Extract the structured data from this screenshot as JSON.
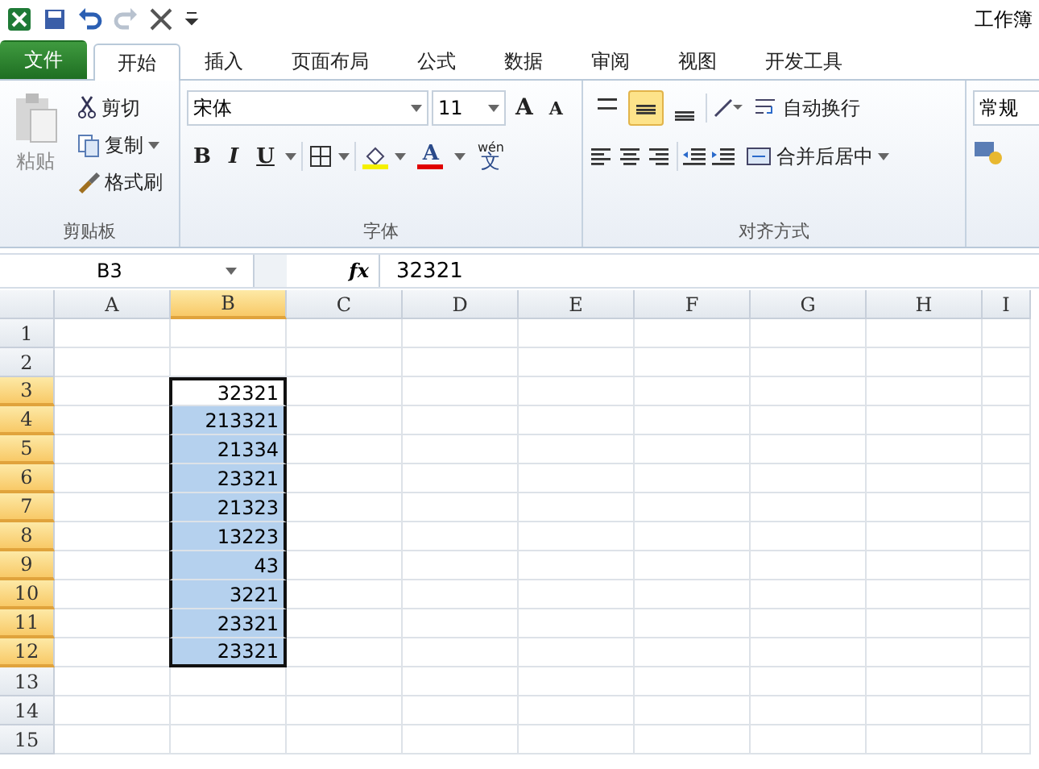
{
  "title_bar": {
    "title": "工作簿"
  },
  "ribbon_tabs": [
    {
      "label": "文件",
      "kind": "file",
      "selected": false
    },
    {
      "label": "开始",
      "kind": "tab",
      "selected": true
    },
    {
      "label": "插入",
      "kind": "tab",
      "selected": false
    },
    {
      "label": "页面布局",
      "kind": "tab",
      "selected": false
    },
    {
      "label": "公式",
      "kind": "tab",
      "selected": false
    },
    {
      "label": "数据",
      "kind": "tab",
      "selected": false
    },
    {
      "label": "审阅",
      "kind": "tab",
      "selected": false
    },
    {
      "label": "视图",
      "kind": "tab",
      "selected": false
    },
    {
      "label": "开发工具",
      "kind": "tab",
      "selected": false
    }
  ],
  "clipboard": {
    "paste": "粘贴",
    "cut": "剪切",
    "copy": "复制",
    "format_painter": "格式刷",
    "label": "剪贴板"
  },
  "font": {
    "font_name": "宋体",
    "font_size": "11",
    "grow": "A",
    "shrink": "A",
    "bold": "B",
    "italic": "I",
    "underline": "U",
    "font_color": "A",
    "phonetic_top": "wén",
    "phonetic": "文",
    "label": "字体"
  },
  "alignment": {
    "vertical": [
      {
        "selected": false
      },
      {
        "selected": true
      },
      {
        "selected": false
      }
    ],
    "wrap": "自动换行",
    "merge": "合并后居中",
    "label": "对齐方式"
  },
  "number": {
    "format": "常规"
  },
  "formula_bar": {
    "name_box": "B3",
    "fx": "fx",
    "value": "32321"
  },
  "columns": [
    {
      "label": "A",
      "selected": false
    },
    {
      "label": "B",
      "selected": true
    },
    {
      "label": "C",
      "selected": false
    },
    {
      "label": "D",
      "selected": false
    },
    {
      "label": "E",
      "selected": false
    },
    {
      "label": "F",
      "selected": false
    },
    {
      "label": "G",
      "selected": false
    },
    {
      "label": "H",
      "selected": false
    },
    {
      "label": "I",
      "selected": false
    }
  ],
  "rows": [
    {
      "label": "1",
      "selected": false
    },
    {
      "label": "2",
      "selected": false
    },
    {
      "label": "3",
      "selected": true,
      "active": true,
      "b": "32321"
    },
    {
      "label": "4",
      "selected": true,
      "active": false,
      "b": "213321"
    },
    {
      "label": "5",
      "selected": true,
      "active": false,
      "b": "21334"
    },
    {
      "label": "6",
      "selected": true,
      "active": false,
      "b": "23321"
    },
    {
      "label": "7",
      "selected": true,
      "active": false,
      "b": "21323"
    },
    {
      "label": "8",
      "selected": true,
      "active": false,
      "b": "13223"
    },
    {
      "label": "9",
      "selected": true,
      "active": false,
      "b": "43"
    },
    {
      "label": "10",
      "selected": true,
      "active": false,
      "b": "3221"
    },
    {
      "label": "11",
      "selected": true,
      "active": false,
      "b": "23321"
    },
    {
      "label": "12",
      "selected": true,
      "active": false,
      "b": "23321"
    },
    {
      "label": "13",
      "selected": false
    },
    {
      "label": "14",
      "selected": false
    },
    {
      "label": "15",
      "selected": false
    }
  ]
}
